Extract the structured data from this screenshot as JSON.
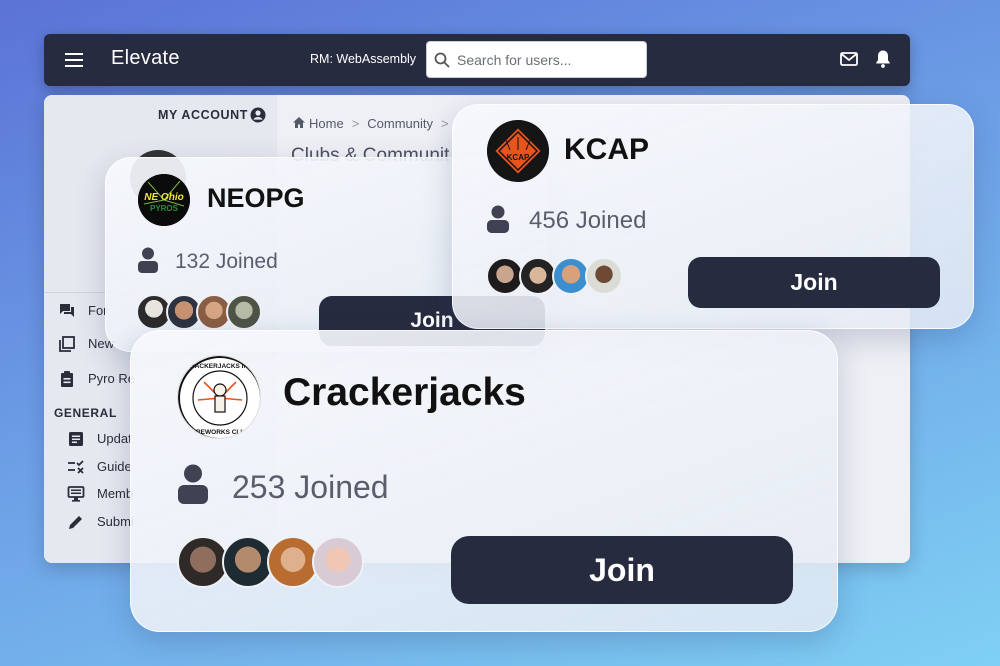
{
  "appbar": {
    "title": "Elevate",
    "rm_label": "RM: WebAssembly",
    "search_placeholder": "Search for users..."
  },
  "sidebar": {
    "my_account": "MY ACCOUNT",
    "items": [
      {
        "label": "For",
        "icon": "forum-icon"
      },
      {
        "label": "New",
        "icon": "library-icon"
      },
      {
        "label": "Pyro Re",
        "icon": "clipboard-icon"
      }
    ],
    "general_heading": "GENERAL",
    "general_items": [
      {
        "label": "Updat",
        "icon": "article-icon"
      },
      {
        "label": "Guide",
        "icon": "checklist-icon"
      },
      {
        "label": "Memb",
        "icon": "monitor-icon"
      },
      {
        "label": "Submi",
        "icon": "pencil-icon"
      }
    ]
  },
  "breadcrumb": {
    "home": "Home",
    "community": "Community"
  },
  "page_heading": "Clubs & Communit",
  "cards": [
    {
      "name": "NEOPG",
      "joined": "132 Joined",
      "join_label": "Join",
      "logo_text": "NE Ohio PYROS"
    },
    {
      "name": "KCAP",
      "joined": "456 Joined",
      "join_label": "Join",
      "logo_text": "KCAP"
    },
    {
      "name": "Crackerjacks",
      "joined": "253 Joined",
      "join_label": "Join",
      "logo_text": "CRACKERJACKS INC. FIREWORKS CLUB"
    }
  ],
  "colors": {
    "appbar": "#272b40",
    "button": "#272b40",
    "kcap_orange": "#e8541c"
  }
}
